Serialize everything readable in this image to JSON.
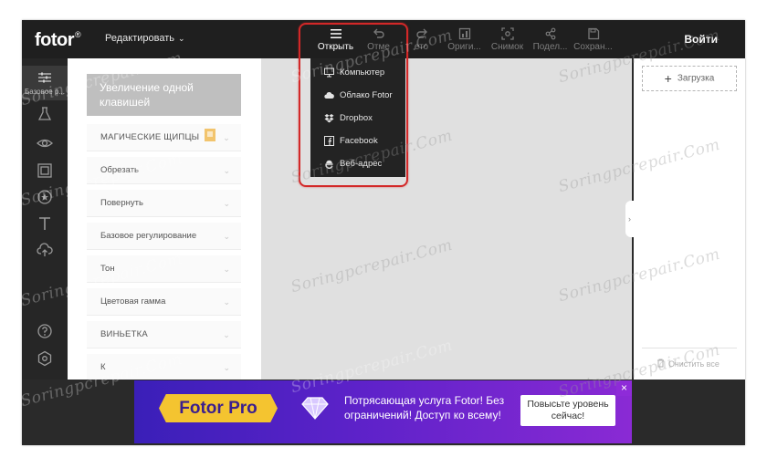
{
  "app": {
    "logo": "fotor",
    "logo_mark": "®",
    "edit_menu_label": "Редактировать",
    "login_label": "Войти"
  },
  "toolbar": [
    {
      "label": "Открыть",
      "icon": "menu-icon",
      "active": true
    },
    {
      "label": "Отме",
      "icon": "undo-icon",
      "active": false
    },
    {
      "label": "ето",
      "icon": "redo-icon",
      "active": false
    },
    {
      "label": "Ориги...",
      "icon": "compare-icon",
      "active": false
    },
    {
      "label": "Снимок",
      "icon": "camera-icon",
      "active": false
    },
    {
      "label": "Подел...",
      "icon": "share-icon",
      "active": false
    },
    {
      "label": "Сохран...",
      "icon": "save-icon",
      "active": false
    }
  ],
  "open_menu": [
    {
      "label": "Компьютер",
      "icon": "monitor-icon"
    },
    {
      "label": "Облако Fotor",
      "icon": "cloud-icon"
    },
    {
      "label": "Dropbox",
      "icon": "dropbox-icon"
    },
    {
      "label": "Facebook",
      "icon": "facebook-icon"
    },
    {
      "label": "Веб-адрес",
      "icon": "web-icon"
    }
  ],
  "sidebar_rail": {
    "basic_label": "Базовое р..."
  },
  "panel": {
    "one_tap_label": "Увеличение одной клавишей",
    "sections": [
      {
        "label": "МАГИЧЕСКИЕ ЩИПЦЫ",
        "premium": true
      },
      {
        "label": "Обрезать",
        "premium": false
      },
      {
        "label": "Повернуть",
        "premium": false
      },
      {
        "label": "Базовое регулирование",
        "premium": false
      },
      {
        "label": "Тон",
        "premium": false
      },
      {
        "label": "Цветовая гамма",
        "premium": false
      },
      {
        "label": "ВИНЬЕТКА",
        "premium": false
      },
      {
        "label": "К",
        "premium": false
      }
    ]
  },
  "right_panel": {
    "upload_label": "Загрузка",
    "clear_label": "Очистить все"
  },
  "ad": {
    "pro_label": "Fotor Pro",
    "message": "Потрясающая услуга Fotor! Без ограничений! Доступ ко всему!",
    "cta_label": "Повысьте уровень сейчас!",
    "close_label": "×"
  },
  "watermark": "Soringpcrepair.Com",
  "colors": {
    "topbar": "#1f1f1f",
    "panel_bg": "#ffffff",
    "canvas_bg": "#e0e0e0",
    "highlight": "#d32828",
    "pro_badge": "#f4c430"
  }
}
